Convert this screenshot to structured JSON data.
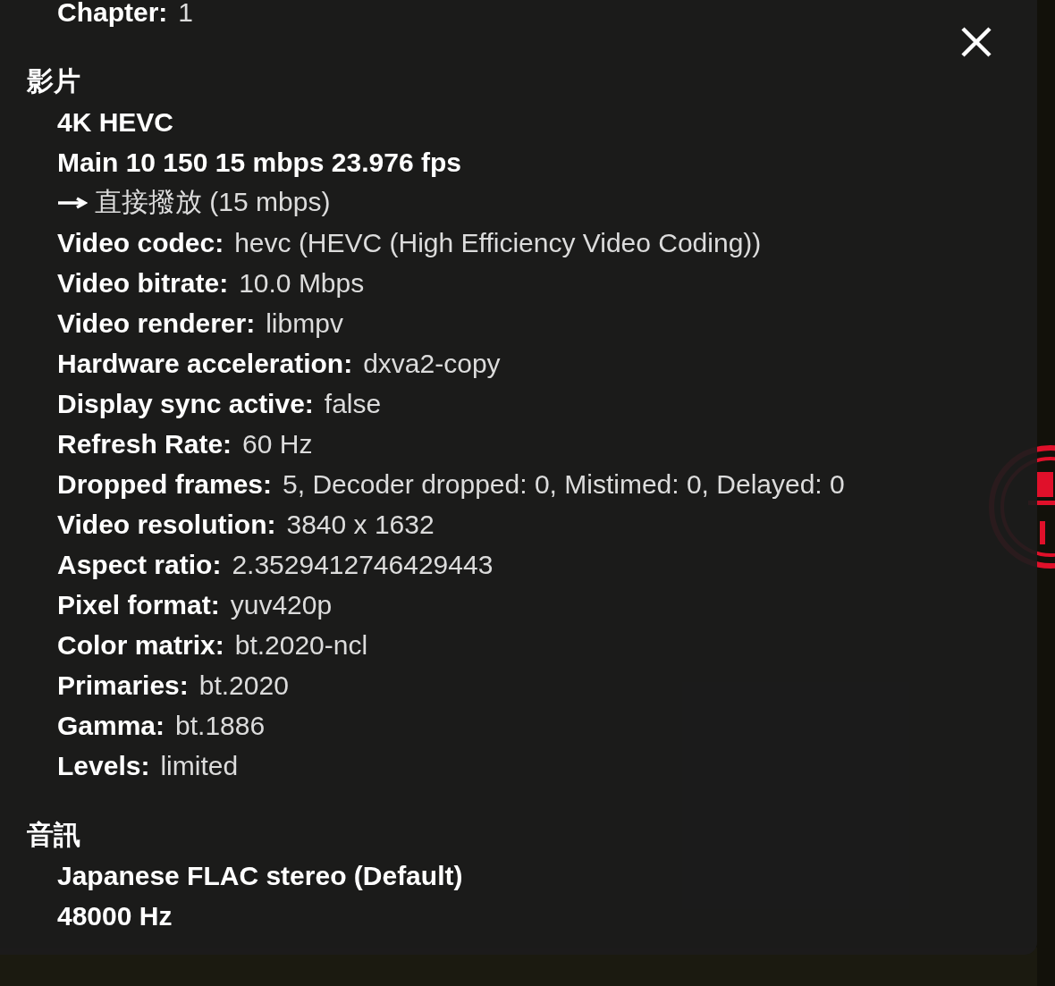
{
  "top_rows": [
    {
      "label": "Chapter:",
      "value": "1"
    }
  ],
  "sections": [
    {
      "title": "影片",
      "lines": [
        {
          "kind": "bold",
          "text": "4K HEVC"
        },
        {
          "kind": "bold",
          "text": "Main 10 150 15 mbps 23.976 fps"
        },
        {
          "kind": "arrow",
          "text": "直接撥放 (15 mbps)"
        },
        {
          "kind": "pair",
          "label": "Video codec:",
          "value": "hevc (HEVC (High Efficiency Video Coding))"
        },
        {
          "kind": "pair",
          "label": "Video bitrate:",
          "value": "10.0 Mbps"
        },
        {
          "kind": "pair",
          "label": "Video renderer:",
          "value": "libmpv"
        },
        {
          "kind": "pair",
          "label": "Hardware acceleration:",
          "value": "dxva2-copy"
        },
        {
          "kind": "pair",
          "label": "Display sync active:",
          "value": "false"
        },
        {
          "kind": "pair",
          "label": "Refresh Rate:",
          "value": "60 Hz"
        },
        {
          "kind": "pair",
          "label": "Dropped frames:",
          "value": "5, Decoder dropped: 0, Mistimed: 0, Delayed: 0"
        },
        {
          "kind": "pair",
          "label": "Video resolution:",
          "value": "3840 x 1632"
        },
        {
          "kind": "pair",
          "label": "Aspect ratio:",
          "value": "2.3529412746429443"
        },
        {
          "kind": "pair",
          "label": "Pixel format:",
          "value": "yuv420p"
        },
        {
          "kind": "pair",
          "label": "Color matrix:",
          "value": "bt.2020-ncl"
        },
        {
          "kind": "pair",
          "label": "Primaries:",
          "value": "bt.2020"
        },
        {
          "kind": "pair",
          "label": "Gamma:",
          "value": "bt.1886"
        },
        {
          "kind": "pair",
          "label": "Levels:",
          "value": "limited"
        }
      ]
    },
    {
      "title": "音訊",
      "lines": [
        {
          "kind": "bold",
          "text": "Japanese FLAC stereo (Default)"
        },
        {
          "kind": "bold",
          "text": "48000 Hz"
        }
      ]
    }
  ]
}
